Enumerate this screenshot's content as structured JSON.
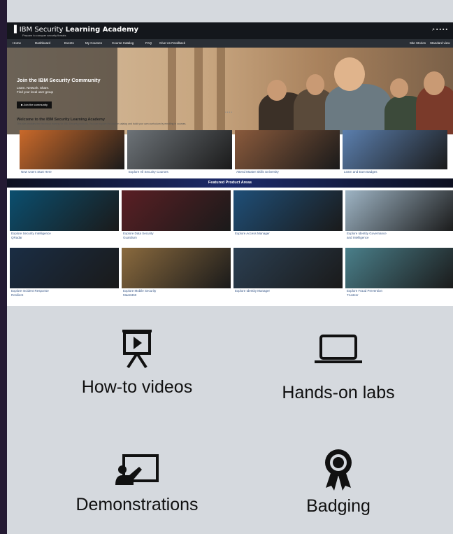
{
  "portal": {
    "brand_prefix": "IBM Security",
    "brand_name": "Learning Academy",
    "tagline": "Prepare to conquer security threats",
    "nav": [
      "Home",
      "Dashboard",
      "Events",
      "My Courses",
      "Course Catalog",
      "FAQ",
      "Give Us Feedback"
    ],
    "nav_right": [
      "Site Stories",
      "Standard view"
    ],
    "hero": {
      "title": "Join the IBM Security Community",
      "lines": [
        "Learn. Network. Share.",
        "Find your local user group"
      ],
      "button": "Join the community"
    },
    "welcome_title": "Welcome to the IBM Security Learning Academy",
    "welcome_desc": "This site provides free technical training for IBM Security products. You can explore the course catalog and build your own curriculum by enrolling in courses.",
    "top_tiles": [
      {
        "caption": "New Users Start Here",
        "color": "#c9692a"
      },
      {
        "caption": "Explore All Security Courses",
        "color": "#6d7378"
      },
      {
        "caption": "Attend Master Skills University",
        "color": "#8a5a3c"
      },
      {
        "caption": "Learn and Earn Badges",
        "color": "#5b7fae"
      }
    ],
    "featured_title": "Featured Product Areas",
    "products": [
      {
        "caption": "Explore Security Intelligence",
        "sub": "QRadar",
        "color": "#0b4f6f"
      },
      {
        "caption": "Explore Data Security",
        "sub": "Guardium",
        "color": "#5a1f24"
      },
      {
        "caption": "Explore Access Manager",
        "sub": "",
        "color": "#1f4f78"
      },
      {
        "caption": "Explore Identity Governance",
        "sub": "and Intelligence",
        "color": "#9eb4c4"
      },
      {
        "caption": "Explore Incident Response",
        "sub": "Resilient",
        "color": "#1a2d44"
      },
      {
        "caption": "Explore Mobile Security",
        "sub": "MaaS360",
        "color": "#8a6a3e"
      },
      {
        "caption": "Explore Identity Manager",
        "sub": "",
        "color": "#2b3f52"
      },
      {
        "caption": "Explore Fraud Prevention",
        "sub": "Trusteer",
        "color": "#4a7f8a"
      }
    ]
  },
  "features": [
    {
      "label": "How-to videos",
      "icon": "presentation-video-icon"
    },
    {
      "label": "Hands-on labs",
      "icon": "laptop-icon"
    },
    {
      "label": "Demonstrations",
      "icon": "presenter-icon"
    },
    {
      "label": "Badging",
      "icon": "badge-ribbon-icon"
    }
  ]
}
